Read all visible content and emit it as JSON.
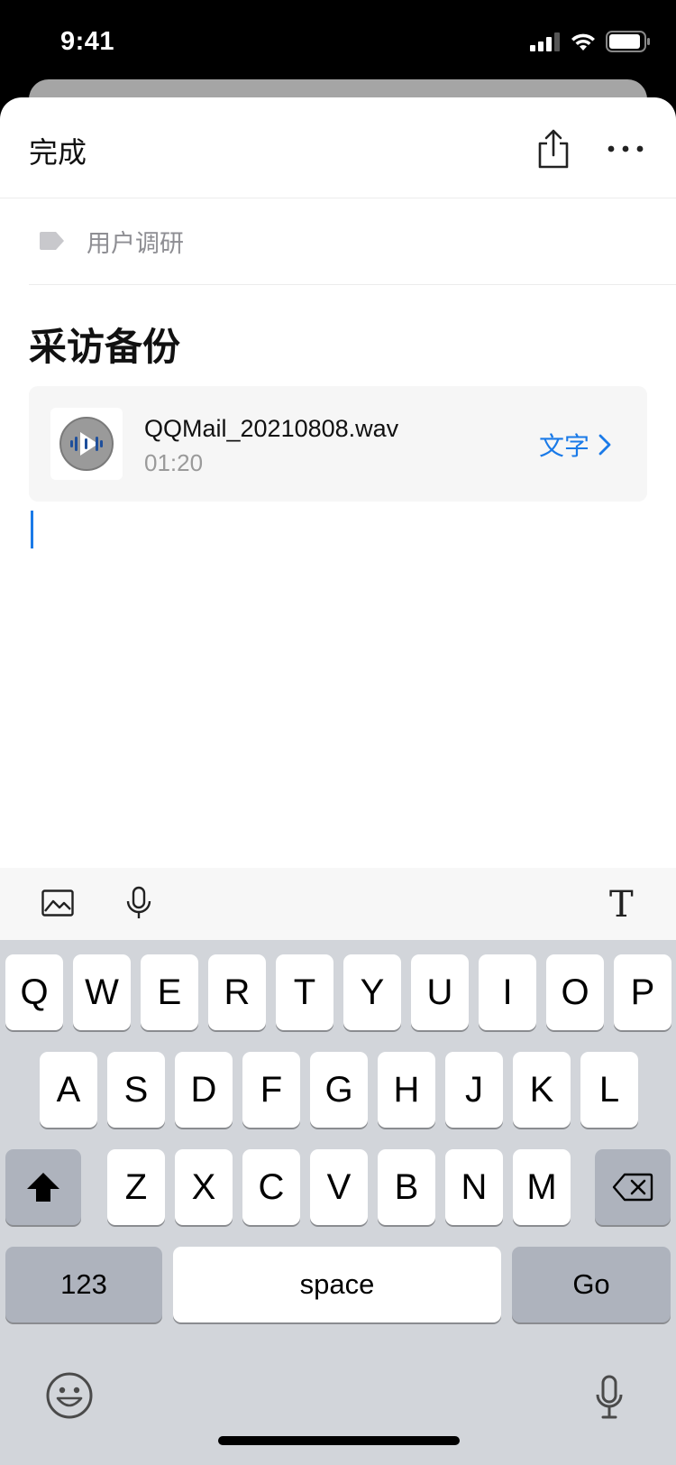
{
  "status_bar": {
    "time": "9:41",
    "icons": [
      "cellular-signal-icon",
      "wifi-icon",
      "battery-icon"
    ]
  },
  "nav": {
    "done_label": "完成",
    "share_icon": "share-icon",
    "more_icon": "more-icon"
  },
  "tag": {
    "icon": "tag-icon",
    "label": "用户调研"
  },
  "note": {
    "title": "采访备份"
  },
  "attachment": {
    "icon": "audio-play-icon",
    "file_name": "QQMail_20210808.wav",
    "duration": "01:20",
    "action_label": "文字",
    "action_icon": "chevron-right-icon"
  },
  "toolbar": {
    "image_icon": "image-icon",
    "mic_icon": "microphone-icon",
    "text_format_label": "T"
  },
  "keyboard": {
    "row1": [
      "Q",
      "W",
      "E",
      "R",
      "T",
      "Y",
      "U",
      "I",
      "O",
      "P"
    ],
    "row2": [
      "A",
      "S",
      "D",
      "F",
      "G",
      "H",
      "J",
      "K",
      "L"
    ],
    "row3": [
      "Z",
      "X",
      "C",
      "V",
      "B",
      "N",
      "M"
    ],
    "numbers_label": "123",
    "space_label": "space",
    "go_label": "Go",
    "emoji_icon": "emoji-icon",
    "dictation_icon": "microphone-icon"
  },
  "colors": {
    "accent": "#1a7ae8",
    "keyboard_bg": "#d2d5da",
    "dark_key": "#aeb3bd"
  }
}
